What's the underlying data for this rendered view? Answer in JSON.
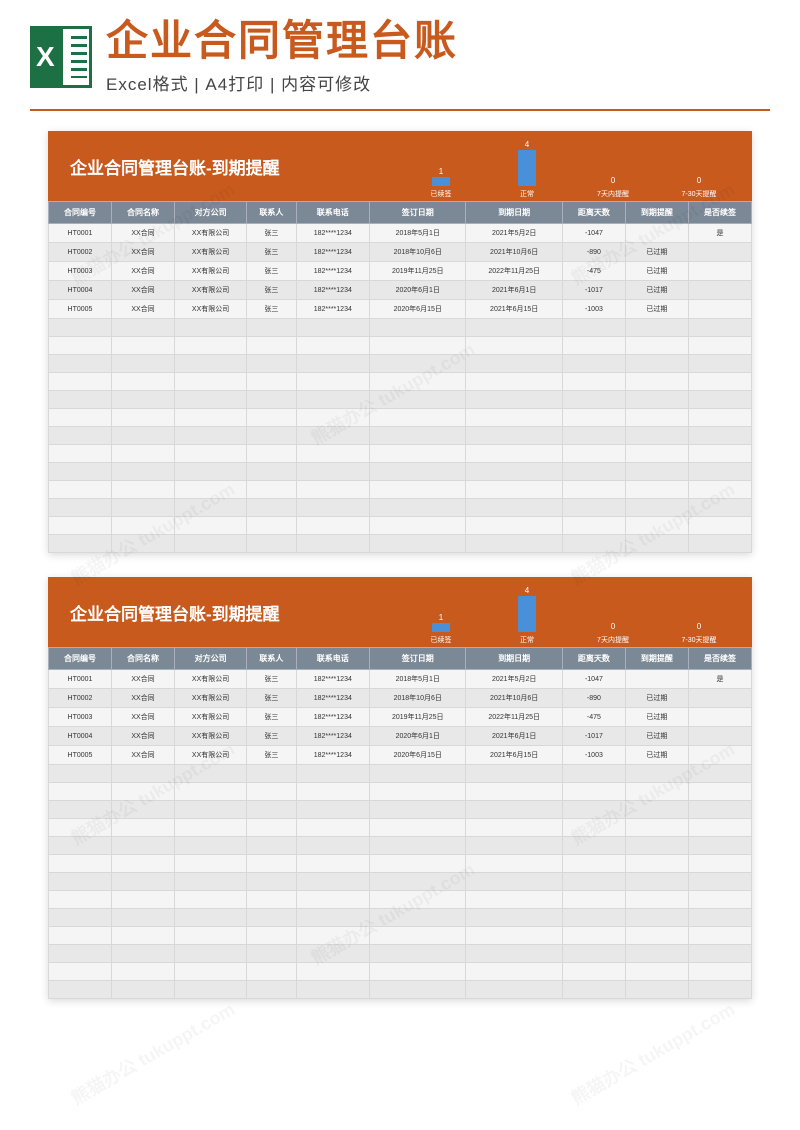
{
  "header": {
    "title": "企业合同管理台账",
    "subtitle": "Excel格式 | A4打印 | 内容可修改",
    "icon_letter": "X"
  },
  "sheet": {
    "title": "企业合同管理台账-到期提醒",
    "columns": [
      "合同编号",
      "合同名称",
      "对方公司",
      "联系人",
      "联系电话",
      "签订日期",
      "到期日期",
      "距离天数",
      "到期提醒",
      "是否续签"
    ],
    "rows": [
      {
        "id": "HT0001",
        "name": "XX合同",
        "company": "XX有限公司",
        "contact": "张三",
        "phone": "182****1234",
        "sign": "2018年5月1日",
        "due": "2021年5月2日",
        "days": "-1047",
        "remind": "",
        "renew": "是"
      },
      {
        "id": "HT0002",
        "name": "XX合同",
        "company": "XX有限公司",
        "contact": "张三",
        "phone": "182****1234",
        "sign": "2018年10月6日",
        "due": "2021年10月6日",
        "days": "-890",
        "remind": "已过期",
        "renew": ""
      },
      {
        "id": "HT0003",
        "name": "XX合同",
        "company": "XX有限公司",
        "contact": "张三",
        "phone": "182****1234",
        "sign": "2019年11月25日",
        "due": "2022年11月25日",
        "days": "-475",
        "remind": "已过期",
        "renew": ""
      },
      {
        "id": "HT0004",
        "name": "XX合同",
        "company": "XX有限公司",
        "contact": "张三",
        "phone": "182****1234",
        "sign": "2020年6月1日",
        "due": "2021年6月1日",
        "days": "-1017",
        "remind": "已过期",
        "renew": ""
      },
      {
        "id": "HT0005",
        "name": "XX合同",
        "company": "XX有限公司",
        "contact": "张三",
        "phone": "182****1234",
        "sign": "2020年6月15日",
        "due": "2021年6月15日",
        "days": "-1003",
        "remind": "已过期",
        "renew": ""
      }
    ],
    "empty_rows": 13
  },
  "chart_data": {
    "type": "bar",
    "categories": [
      "已续签",
      "正常",
      "7天内提醒",
      "7-30天提醒"
    ],
    "values": [
      1,
      4,
      0,
      0
    ],
    "title": "",
    "xlabel": "",
    "ylabel": "",
    "ylim": [
      0,
      4
    ]
  },
  "watermark": "熊猫办公 tukuppt.com"
}
